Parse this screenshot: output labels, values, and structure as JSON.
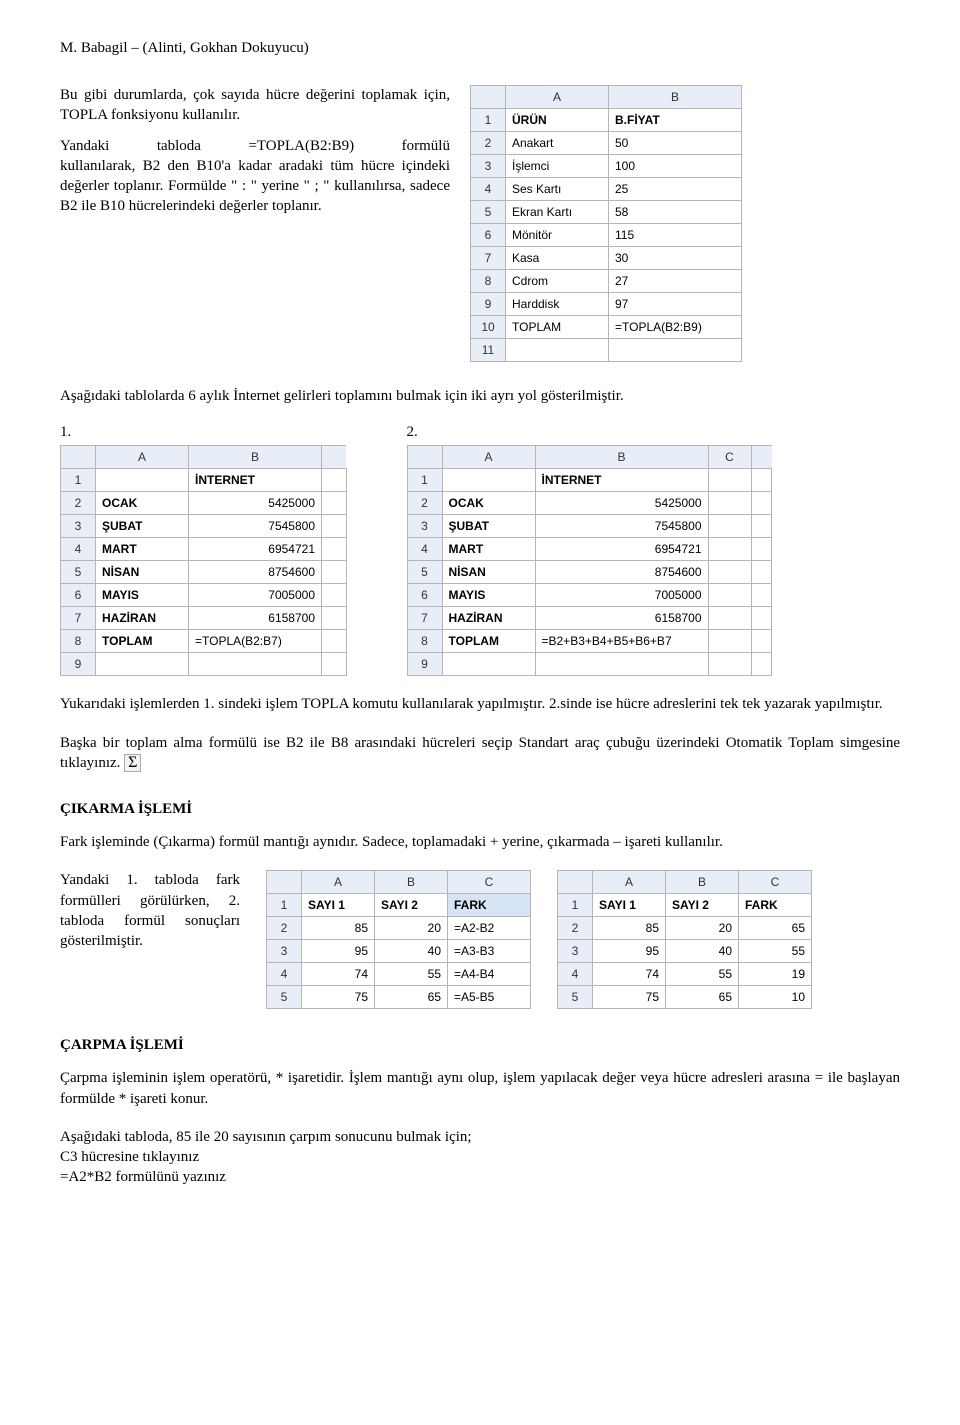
{
  "header": "M. Babagil – (Alinti, Gokhan Dokuyucu)",
  "intro": {
    "p1a": "Bu gibi durumlarda, çok sayıda hücre değerini toplamak için, TOPLA fonksiyonu kullanılır.",
    "p1b_l1": "Yandaki",
    "p1b_l2": "tabloda",
    "p1b_l3": "=TOPLA(B2:B9)",
    "p1b_l4": "formülü",
    "p1b_rest": "kullanılarak, B2 den B10'a kadar aradaki tüm hücre içindeki değerler toplanır. Formülde \" : \" yerine \" ; \" kullanılırsa, sadece B2 ile B10 hücrelerindeki değerler toplanır."
  },
  "table_urun": {
    "cols": [
      "A",
      "B"
    ],
    "rows": [
      {
        "n": "1",
        "a": "ÜRÜN",
        "b": "B.FİYAT",
        "bold": true
      },
      {
        "n": "2",
        "a": "Anakart",
        "b": "50"
      },
      {
        "n": "3",
        "a": "İşlemci",
        "b": "100"
      },
      {
        "n": "4",
        "a": "Ses Kartı",
        "b": "25"
      },
      {
        "n": "5",
        "a": "Ekran Kartı",
        "b": "58"
      },
      {
        "n": "6",
        "a": "Mönitör",
        "b": "115"
      },
      {
        "n": "7",
        "a": "Kasa",
        "b": "30"
      },
      {
        "n": "8",
        "a": "Cdrom",
        "b": "27"
      },
      {
        "n": "9",
        "a": "Harddisk",
        "b": "97"
      },
      {
        "n": "10",
        "a": "TOPLAM",
        "b": "=TOPLA(B2:B9)"
      },
      {
        "n": "11",
        "a": "",
        "b": ""
      }
    ]
  },
  "mid_para": "Aşağıdaki tablolarda 6 aylık İnternet gelirleri toplamını bulmak için iki ayrı yol gösterilmiştir.",
  "labels": {
    "one": "1.",
    "two": "2."
  },
  "table_internet1": {
    "cols": [
      "A",
      "B"
    ],
    "rows": [
      {
        "n": "1",
        "a": "",
        "b": "İNTERNET",
        "bold_b": true
      },
      {
        "n": "2",
        "a": "OCAK",
        "b": "5425000",
        "bold_a": true
      },
      {
        "n": "3",
        "a": "ŞUBAT",
        "b": "7545800",
        "bold_a": true
      },
      {
        "n": "4",
        "a": "MART",
        "b": "6954721",
        "bold_a": true
      },
      {
        "n": "5",
        "a": "NİSAN",
        "b": "8754600",
        "bold_a": true
      },
      {
        "n": "6",
        "a": "MAYIS",
        "b": "7005000",
        "bold_a": true
      },
      {
        "n": "7",
        "a": "HAZİRAN",
        "b": "6158700",
        "bold_a": true
      },
      {
        "n": "8",
        "a": "TOPLAM",
        "b": "=TOPLA(B2:B7)",
        "bold_a": true
      },
      {
        "n": "9",
        "a": "",
        "b": ""
      }
    ]
  },
  "table_internet2": {
    "cols": [
      "A",
      "B",
      "C"
    ],
    "rows": [
      {
        "n": "1",
        "a": "",
        "b": "İNTERNET",
        "bold_b": true
      },
      {
        "n": "2",
        "a": "OCAK",
        "b": "5425000",
        "bold_a": true
      },
      {
        "n": "3",
        "a": "ŞUBAT",
        "b": "7545800",
        "bold_a": true
      },
      {
        "n": "4",
        "a": "MART",
        "b": "6954721",
        "bold_a": true
      },
      {
        "n": "5",
        "a": "NİSAN",
        "b": "8754600",
        "bold_a": true
      },
      {
        "n": "6",
        "a": "MAYIS",
        "b": "7005000",
        "bold_a": true
      },
      {
        "n": "7",
        "a": "HAZİRAN",
        "b": "6158700",
        "bold_a": true
      },
      {
        "n": "8",
        "a": "TOPLAM",
        "b": "=B2+B3+B4+B5+B6+B7",
        "bold_a": true
      },
      {
        "n": "9",
        "a": "",
        "b": ""
      }
    ]
  },
  "para_after_tables": "Yukarıdaki işlemlerden 1. sindeki işlem TOPLA komutu kullanılarak yapılmıştır. 2.sinde ise hücre adreslerini tek tek yazarak yapılmıştır.",
  "para_sigma_pre": "Başka bir toplam alma formülü ise B2 ile B8 arasındaki hücreleri seçip Standart araç çubuğu üzerindeki Otomatik Toplam simgesine tıklayınız.",
  "sigma": "Σ",
  "cikarma": {
    "title": "ÇIKARMA İŞLEMİ",
    "para": "Fark işleminde (Çıkarma) formül mantığı aynıdır. Sadece, toplamadaki + yerine, çıkarmada – işareti kullanılır.",
    "side_l1a": "Yandaki",
    "side_l1b": "1.",
    "side_l1c": "tabloda",
    "side_l1d": "fark",
    "side_l2a": "formülleri",
    "side_l2b": "görülürken,",
    "side_l2c": "2.",
    "side_l3": "tabloda formül sonuçları gösterilmiştir."
  },
  "table_fark1": {
    "cols": [
      "A",
      "B",
      "C"
    ],
    "rows": [
      {
        "n": "1",
        "a": "SAYI 1",
        "b": "SAYI 2",
        "c": "FARK",
        "bold": true,
        "sel_c": true
      },
      {
        "n": "2",
        "a": "85",
        "b": "20",
        "c": "=A2-B2"
      },
      {
        "n": "3",
        "a": "95",
        "b": "40",
        "c": "=A3-B3"
      },
      {
        "n": "4",
        "a": "74",
        "b": "55",
        "c": "=A4-B4"
      },
      {
        "n": "5",
        "a": "75",
        "b": "65",
        "c": "=A5-B5"
      }
    ]
  },
  "table_fark2": {
    "cols": [
      "A",
      "B",
      "C"
    ],
    "rows": [
      {
        "n": "1",
        "a": "SAYI 1",
        "b": "SAYI 2",
        "c": "FARK",
        "bold": true
      },
      {
        "n": "2",
        "a": "85",
        "b": "20",
        "c": "65"
      },
      {
        "n": "3",
        "a": "95",
        "b": "40",
        "c": "55"
      },
      {
        "n": "4",
        "a": "74",
        "b": "55",
        "c": "19"
      },
      {
        "n": "5",
        "a": "75",
        "b": "65",
        "c": "10"
      }
    ]
  },
  "carpma": {
    "title": "ÇARPMA İŞLEMİ",
    "p1": "Çarpma işleminin işlem operatörü, * işaretidir. İşlem mantığı aynı olup, işlem yapılacak değer veya hücre adresleri arasına = ile başlayan formülde * işareti konur.",
    "p2_l1": "Aşağıdaki tabloda, 85 ile 20 sayısının çarpım sonucunu bulmak için;",
    "p2_l2": "C3 hücresine tıklayınız",
    "p2_l3": "=A2*B2 formülünü yazınız"
  }
}
